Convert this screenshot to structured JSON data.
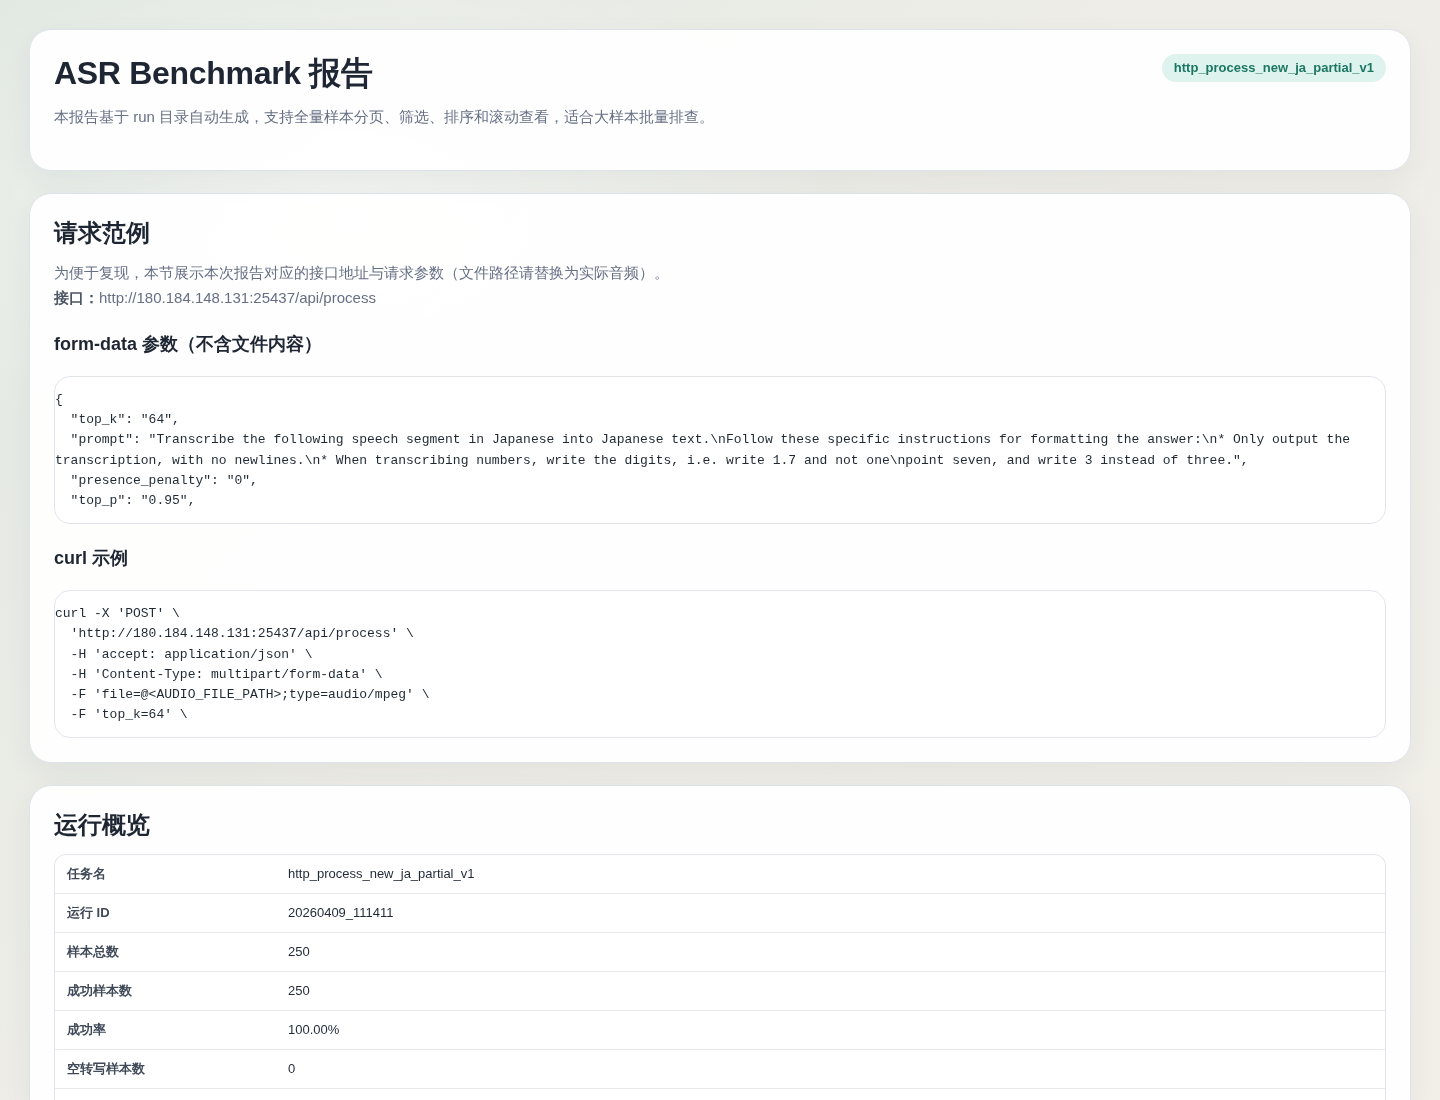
{
  "header": {
    "title": "ASR Benchmark 报告",
    "description": "本报告基于 run 目录自动生成，支持全量样本分页、筛选、排序和滚动查看，适合大样本批量排查。",
    "badge": "http_process_new_ja_partial_v1"
  },
  "request_example": {
    "title": "请求范例",
    "description": "为便于复现，本节展示本次报告对应的接口地址与请求参数（文件路径请替换为实际音频）。",
    "endpoint": "**接口：**http://180.184.148.131:25437/api/process",
    "blocks": [
      {
        "title": "form-data 参数（不含文件内容）",
        "code_lines": [
          "{",
          "  \"top_k\": \"64\",",
          "  \"prompt\": \"Transcribe the following speech segment in Japanese into Japanese text.\\nFollow these specific instructions for formatting the answer:\\n* Only output the transcription, with no newlines.\\n* When transcribing numbers, write the digits, i.e. write 1.7 and not one\\npoint seven, and write 3 instead of three.\",",
          "  \"presence_penalty\": \"0\",",
          "  \"top_p\": \"0.95\","
        ]
      },
      {
        "title": "curl 示例",
        "code_lines": [
          "curl -X 'POST' \\",
          "  'http://180.184.148.131:25437/api/process' \\",
          "  -H 'accept: application/json' \\",
          "  -H 'Content-Type: multipart/form-data' \\",
          "  -F 'file=@<AUDIO_FILE_PATH>;type=audio/mpeg' \\",
          "  -F 'top_k=64' \\"
        ]
      }
    ]
  },
  "run_overview": {
    "title": "运行概览",
    "rows": [
      {
        "label": "任务名",
        "value": "http_process_new_ja_partial_v1"
      },
      {
        "label": "运行 ID",
        "value": "20260409_111411"
      },
      {
        "label": "样本总数",
        "value": "250"
      },
      {
        "label": "成功样本数",
        "value": "250"
      },
      {
        "label": "成功率",
        "value": "100.00%"
      },
      {
        "label": "空转写样本数",
        "value": "0"
      }
    ]
  }
}
